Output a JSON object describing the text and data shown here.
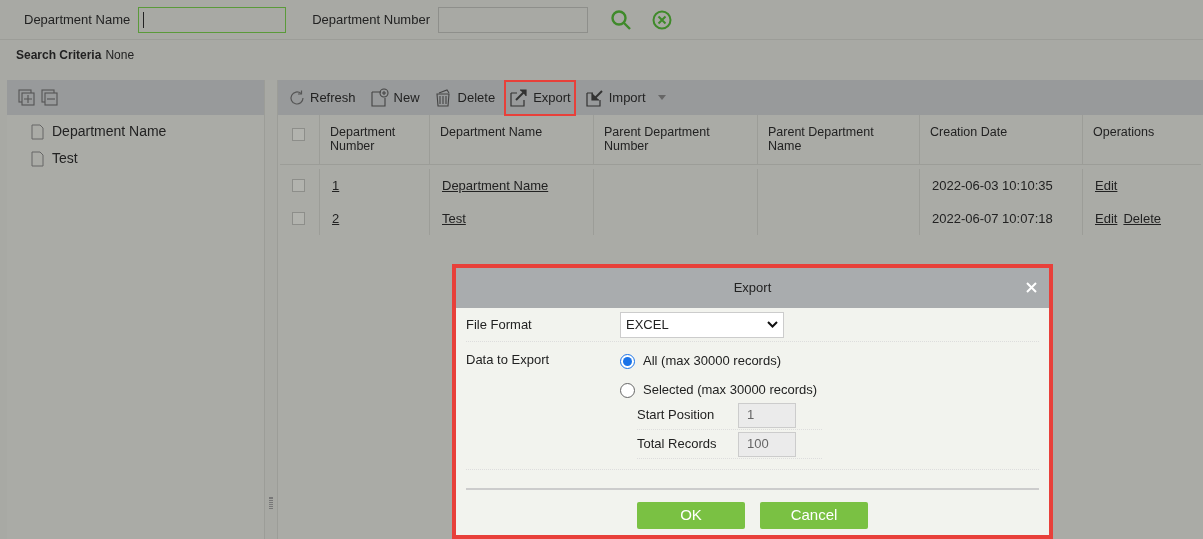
{
  "search_bar": {
    "fields": [
      {
        "label": "Department Name",
        "focused": true
      },
      {
        "label": "Department Number",
        "focused": false
      }
    ]
  },
  "search_criteria": {
    "label": "Search Criteria",
    "value": "None"
  },
  "tree": {
    "items": [
      {
        "label": "Department Name"
      },
      {
        "label": "Test"
      }
    ]
  },
  "toolbar": [
    {
      "kind": "refresh",
      "label": "Refresh",
      "highlighted": false,
      "dropdown": false
    },
    {
      "kind": "new",
      "label": "New",
      "highlighted": false,
      "dropdown": false
    },
    {
      "kind": "delete",
      "label": "Delete",
      "highlighted": false,
      "dropdown": false
    },
    {
      "kind": "export",
      "label": "Export",
      "highlighted": true,
      "dropdown": false
    },
    {
      "kind": "import",
      "label": "Import",
      "highlighted": false,
      "dropdown": true
    }
  ],
  "table": {
    "all_checked": false,
    "columns": [
      "Department Number",
      "Department Name",
      "Parent Department Number",
      "Parent Department Name",
      "Creation Date",
      "Operations"
    ],
    "rows": [
      {
        "checked": false,
        "number": "1",
        "name": "Department Name",
        "created": "2022-06-03 10:10:35",
        "operations": [
          "Edit"
        ]
      },
      {
        "checked": false,
        "number": "2",
        "name": "Test",
        "created": "2022-06-07 10:07:18",
        "operations": [
          "Edit",
          "Delete"
        ]
      }
    ]
  },
  "dialog": {
    "title": "Export",
    "highlighted": true,
    "file_format": {
      "label": "File Format",
      "value": "EXCEL"
    },
    "data_to_export": {
      "label": "Data to Export",
      "options": [
        {
          "label": "All (max 30000 records)",
          "selected": true
        },
        {
          "label": "Selected (max 30000 records)",
          "selected": false
        }
      ]
    },
    "start_position": {
      "label": "Start Position",
      "value": "1"
    },
    "total_records": {
      "label": "Total Records",
      "value": "100"
    },
    "buttons": [
      "OK",
      "Cancel"
    ]
  }
}
